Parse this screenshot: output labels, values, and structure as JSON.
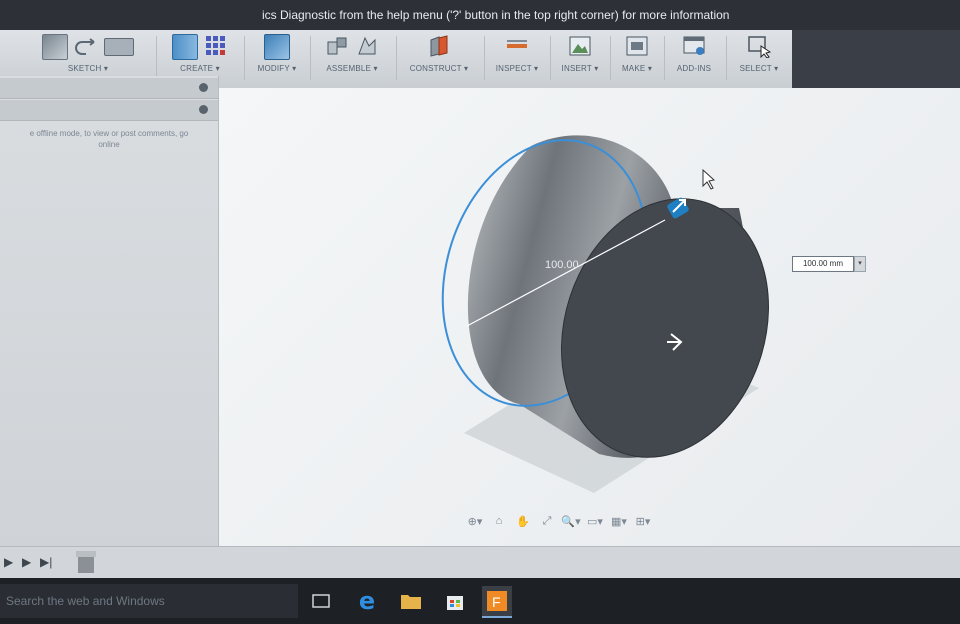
{
  "notice": {
    "text": "ics Diagnostic from the help menu ('?' button in the top right corner) for more information"
  },
  "toolbar": {
    "groups": [
      {
        "label": "SKETCH ▾"
      },
      {
        "label": "CREATE ▾"
      },
      {
        "label": "MODIFY ▾"
      },
      {
        "label": "ASSEMBLE ▾"
      },
      {
        "label": "CONSTRUCT ▾"
      },
      {
        "label": "INSPECT ▾"
      },
      {
        "label": "INSERT ▾"
      },
      {
        "label": "MAKE ▾"
      },
      {
        "label": "ADD-INS"
      },
      {
        "label": "SELECT ▾"
      }
    ]
  },
  "browser": {
    "message_line1": "e offline mode, to view or post comments, go",
    "message_line2": "online"
  },
  "viewport": {
    "dimension_label": "100.00",
    "dimension_input": "100.00 mm",
    "dropdown": "▾"
  },
  "navbar": {
    "items": [
      "⊕▾",
      "⌂",
      "✋",
      "⤢",
      "🔍▾",
      "▭▾",
      "▦▾",
      "⊞▾"
    ]
  },
  "timeline": {
    "play": "▶",
    "next": "▶",
    "end": "▶|"
  },
  "taskbar": {
    "search_placeholder": "Search the web and Windows"
  },
  "colors": {
    "accent": "#1e7fc2",
    "selection": "#3a8fd8"
  }
}
